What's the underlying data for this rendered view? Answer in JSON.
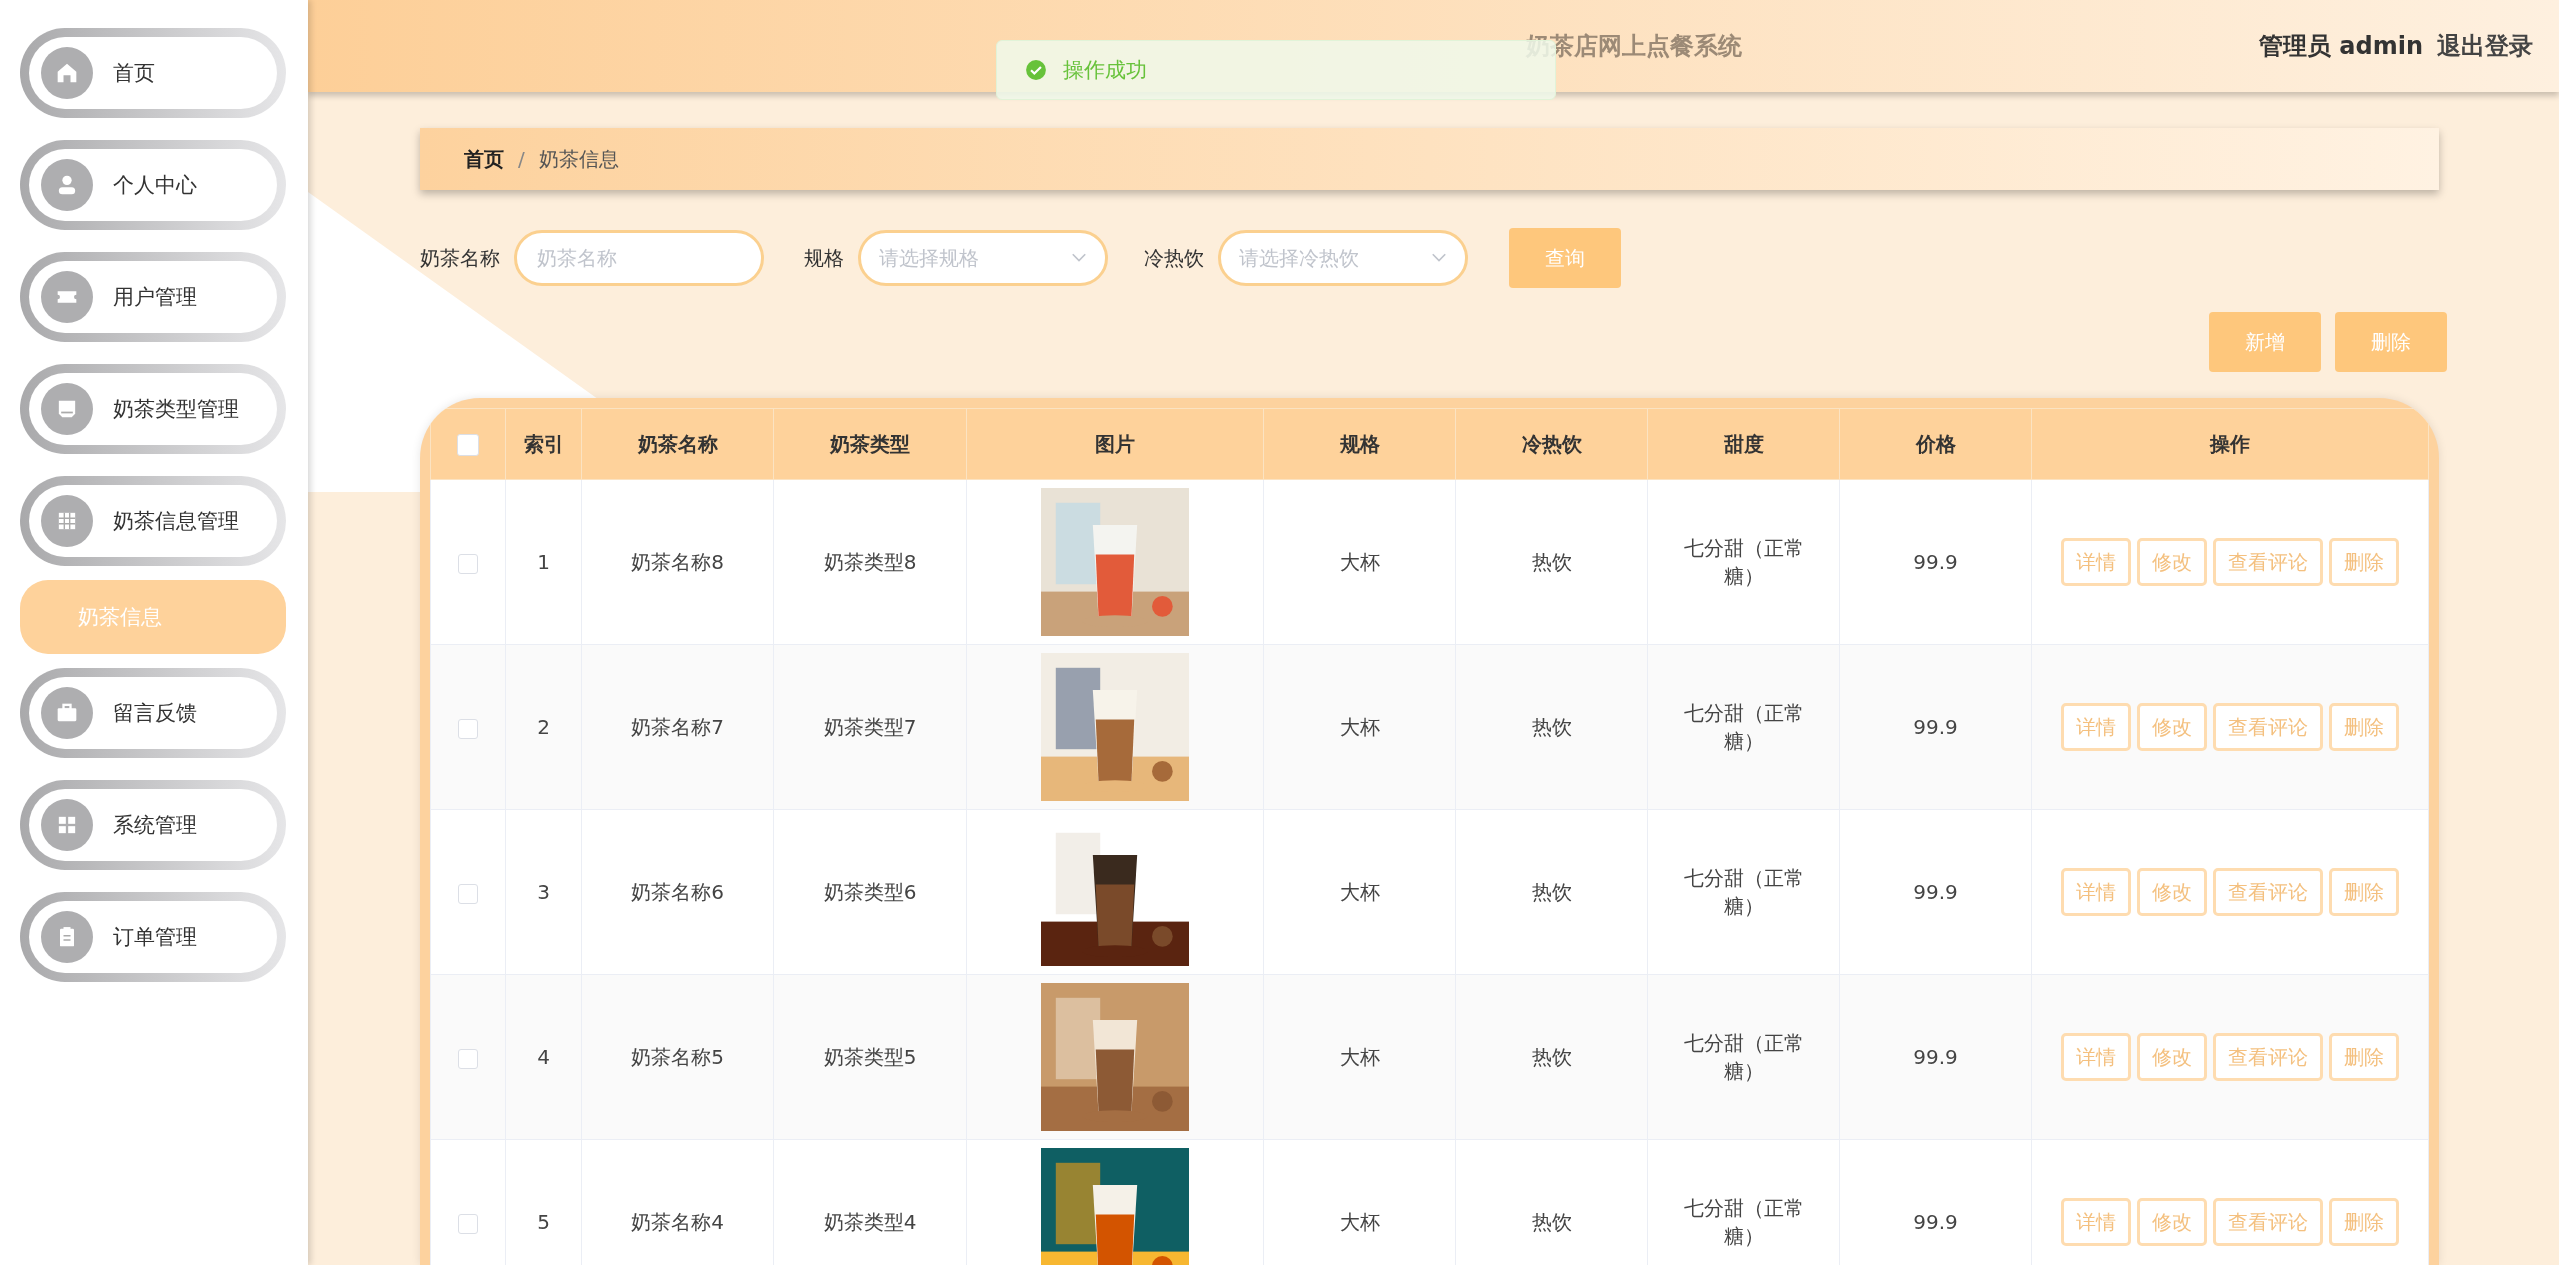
{
  "sidebar": {
    "items": [
      {
        "label": "首页",
        "selected": false
      },
      {
        "label": "个人中心",
        "selected": false
      },
      {
        "label": "用户管理",
        "selected": false
      },
      {
        "label": "奶茶类型管理",
        "selected": false
      },
      {
        "label": "奶茶信息管理",
        "selected": false,
        "children": [
          {
            "label": "奶茶信息",
            "selected": true
          }
        ]
      },
      {
        "label": "留言反馈",
        "selected": false
      },
      {
        "label": "系统管理",
        "selected": false
      },
      {
        "label": "订单管理",
        "selected": false
      }
    ]
  },
  "header": {
    "title": "奶茶店网上点餐系统",
    "user": "管理员 admin",
    "logout": "退出登录"
  },
  "toast": {
    "message": "操作成功"
  },
  "breadcrumb": [
    "首页",
    "奶茶信息"
  ],
  "breadcrumb_separator": "/",
  "filters": [
    {
      "kind": "text",
      "label": "奶茶名称",
      "placeholder": "奶茶名称"
    },
    {
      "kind": "select",
      "label": "规格",
      "placeholder": "请选择规格"
    },
    {
      "kind": "select",
      "label": "冷热饮",
      "placeholder": "请选择冷热饮"
    }
  ],
  "search_button": "查询",
  "toolbar_buttons": [
    "新增",
    "删除"
  ],
  "table": {
    "select_all_checked": false,
    "columns": [
      "索引",
      "奶茶名称",
      "奶茶类型",
      "图片",
      "规格",
      "冷热饮",
      "甜度",
      "价格",
      "操作"
    ],
    "rows": [
      {
        "checked": false,
        "cells": [
          "1",
          "奶茶名称8",
          "奶茶类型8",
          "",
          "大杯",
          "热饮",
          "七分甜（正常糖）",
          "99.9"
        ],
        "image": {
          "kind": "picture"
        },
        "actions": [
          "详情",
          "修改",
          "查看评论",
          "删除"
        ]
      },
      {
        "checked": false,
        "cells": [
          "2",
          "奶茶名称7",
          "奶茶类型7",
          "",
          "大杯",
          "热饮",
          "七分甜（正常糖）",
          "99.9"
        ],
        "image": {
          "kind": "picture"
        },
        "actions": [
          "详情",
          "修改",
          "查看评论",
          "删除"
        ]
      },
      {
        "checked": false,
        "cells": [
          "3",
          "奶茶名称6",
          "奶茶类型6",
          "",
          "大杯",
          "热饮",
          "七分甜（正常糖）",
          "99.9"
        ],
        "image": {
          "kind": "picture"
        },
        "actions": [
          "详情",
          "修改",
          "查看评论",
          "删除"
        ]
      },
      {
        "checked": false,
        "cells": [
          "4",
          "奶茶名称5",
          "奶茶类型5",
          "",
          "大杯",
          "热饮",
          "七分甜（正常糖）",
          "99.9"
        ],
        "image": {
          "kind": "picture"
        },
        "actions": [
          "详情",
          "修改",
          "查看评论",
          "删除"
        ]
      },
      {
        "checked": false,
        "cells": [
          "5",
          "奶茶名称4",
          "奶茶类型4",
          "",
          "大杯",
          "热饮",
          "七分甜（正常糖）",
          "99.9"
        ],
        "image": {
          "kind": "picture"
        },
        "actions": [
          "详情",
          "修改",
          "查看评论",
          "删除"
        ]
      }
    ]
  }
}
